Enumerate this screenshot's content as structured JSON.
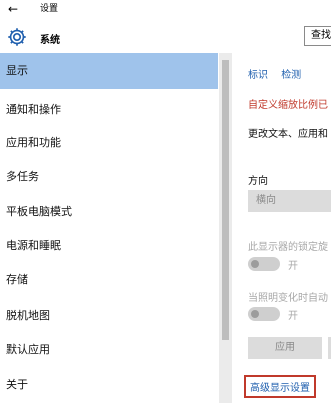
{
  "titlebar": {
    "back_label": "←",
    "title": "设置"
  },
  "header": {
    "title": "系统",
    "search_label": "查找",
    "icon": "gear-icon"
  },
  "sidebar": {
    "items": [
      {
        "label": "显示",
        "active": true
      },
      {
        "label": "通知和操作",
        "active": false
      },
      {
        "label": "应用和功能",
        "active": false
      },
      {
        "label": "多任务",
        "active": false
      },
      {
        "label": "平板电脑模式",
        "active": false
      },
      {
        "label": "电源和睡眠",
        "active": false
      },
      {
        "label": "存储",
        "active": false
      },
      {
        "label": "脱机地图",
        "active": false
      },
      {
        "label": "默认应用",
        "active": false
      },
      {
        "label": "关于",
        "active": false
      }
    ]
  },
  "content": {
    "link_identify": "标识",
    "link_detect": "检测",
    "warning_text": "自定义缩放比例已",
    "description": "更改文本、应用和",
    "orientation_label": "方向",
    "orientation_value": "横向",
    "lock_text": "此显示器的锁定旋",
    "toggle1_label": "开",
    "brightness_text": "当照明变化时自动",
    "toggle2_label": "开",
    "apply_label": "应用",
    "advanced_link": "高级显示设置"
  },
  "colors": {
    "active_nav": "#9fc3eb",
    "link": "#1f5fae",
    "warning": "#c0392b",
    "highlight_border": "#c0392b"
  }
}
